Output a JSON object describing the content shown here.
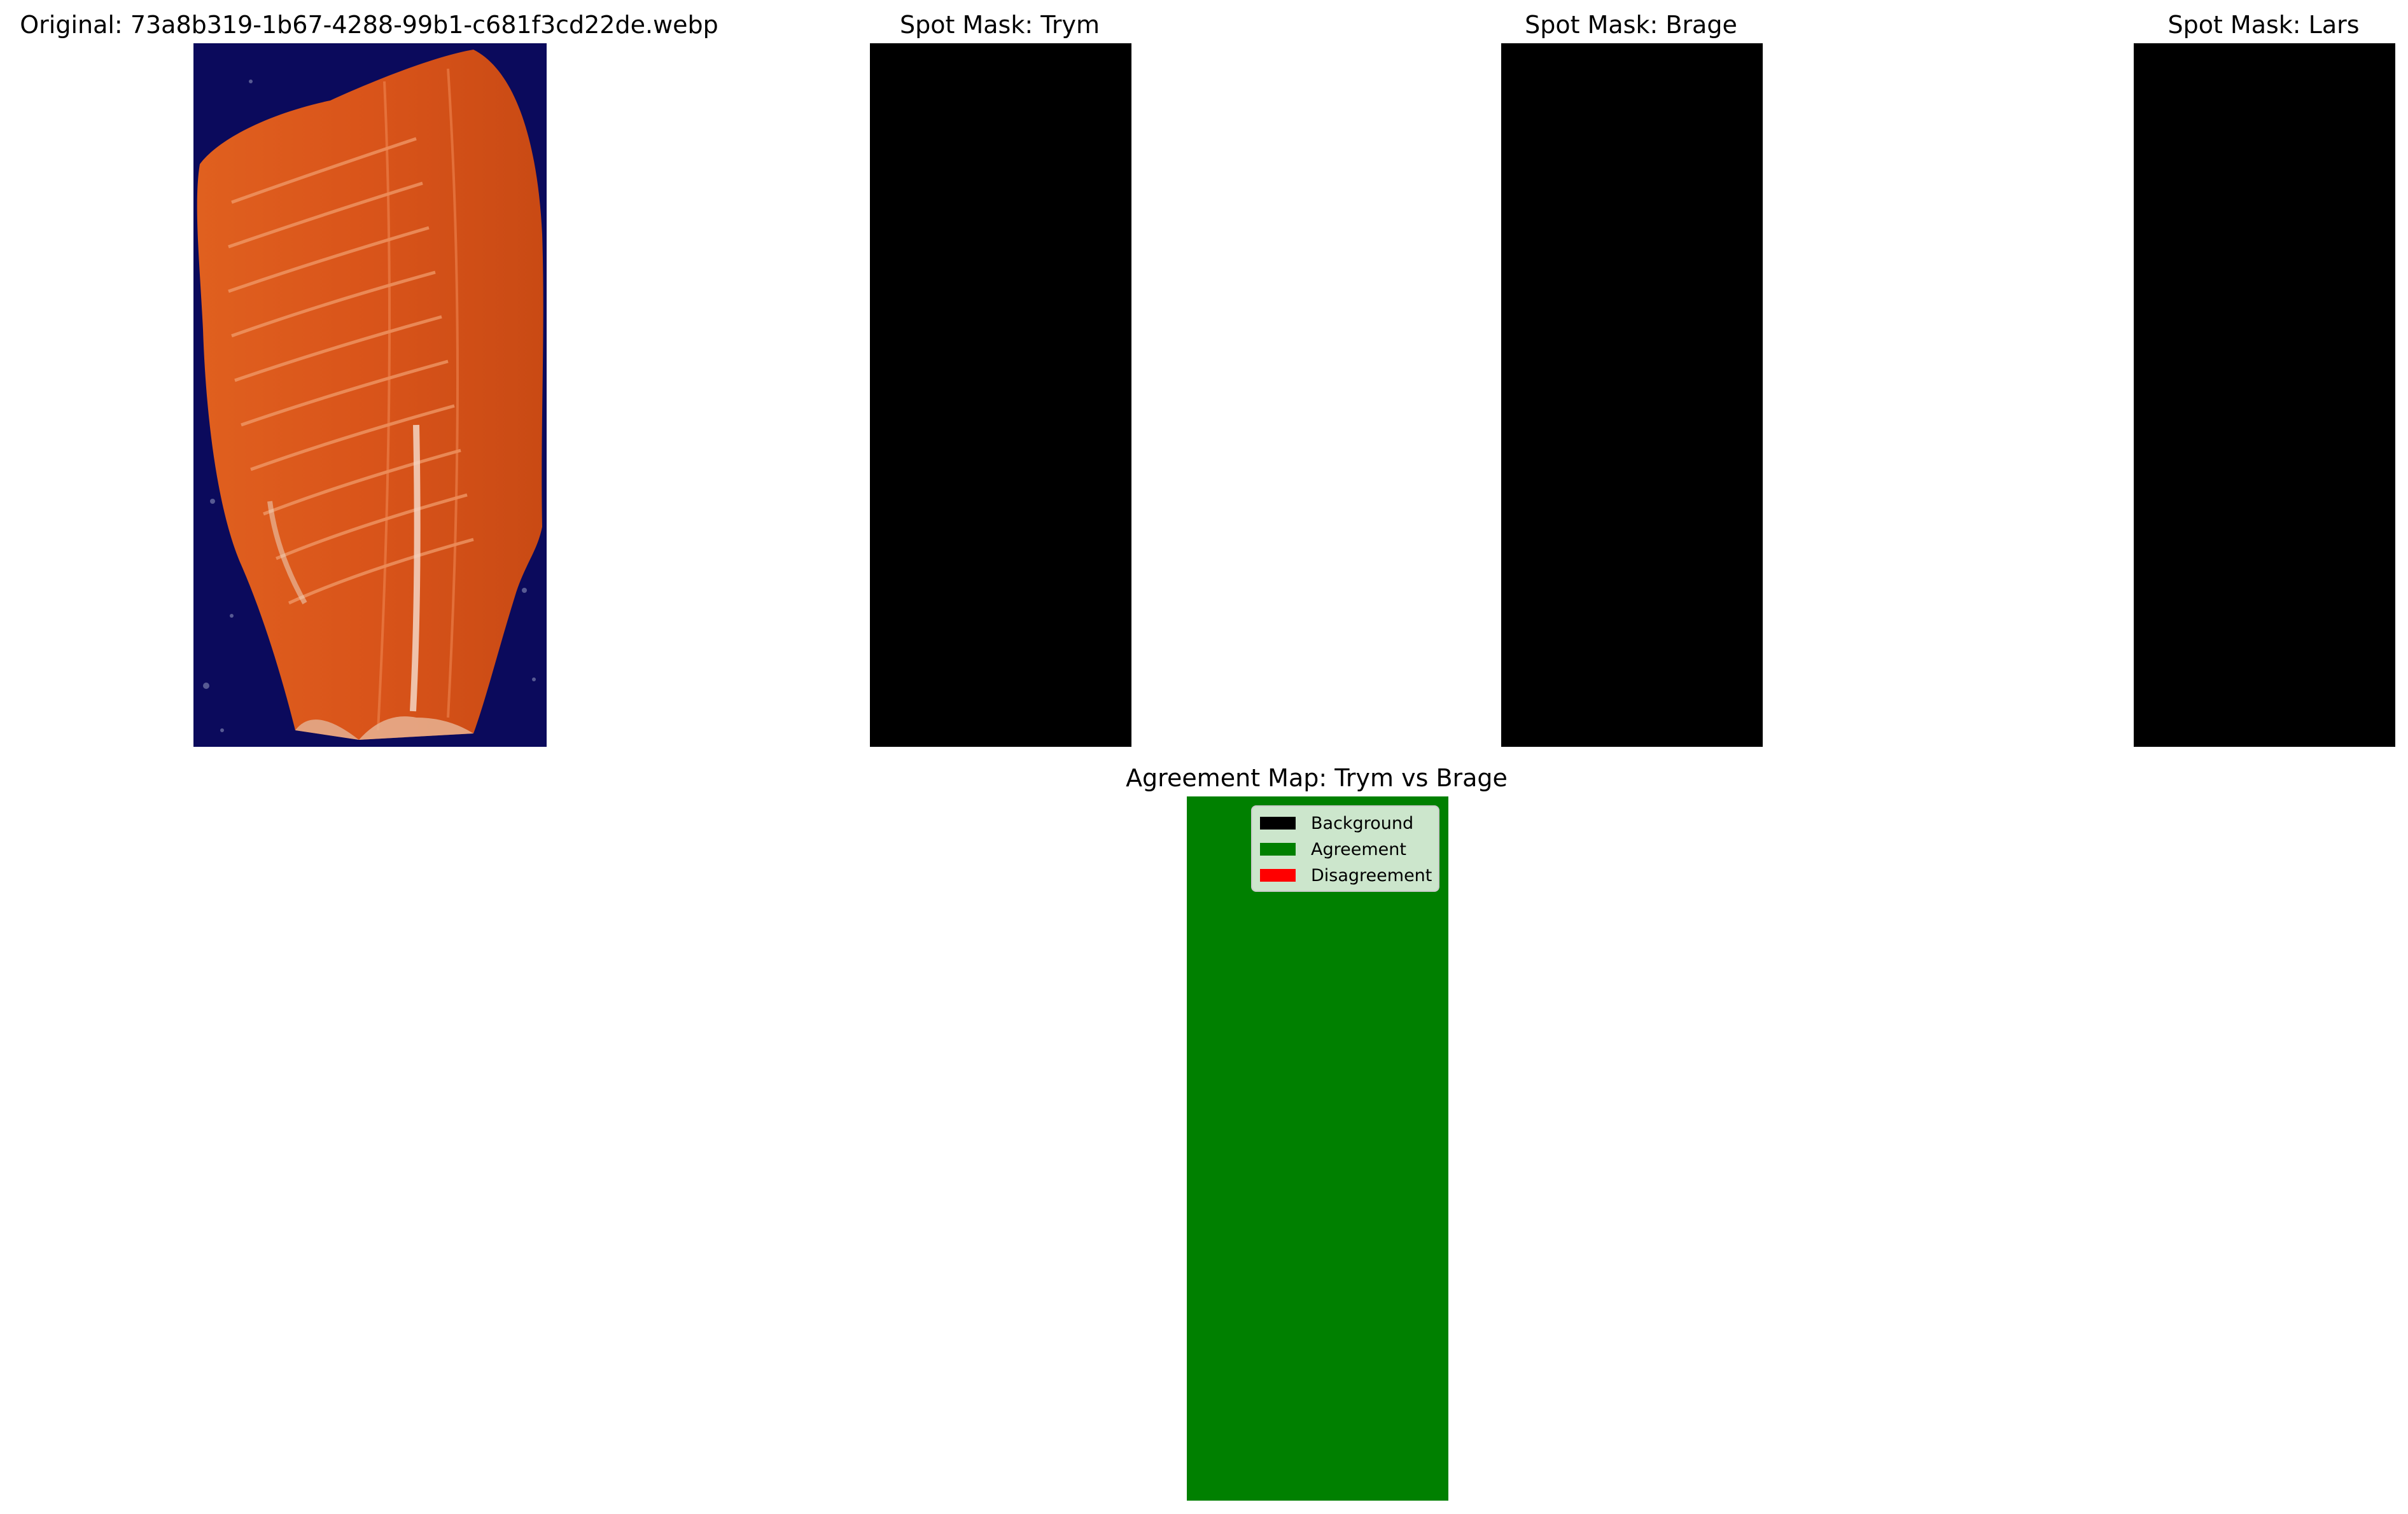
{
  "panels": {
    "original": {
      "title": "Original: 73a8b319-1b67-4288-99b1-c681f3cd22de.webp",
      "background_color": "#0b0a5c",
      "fillet_color": "#d9541a"
    },
    "mask_trym": {
      "title": "Spot Mask: Trym",
      "fill_color": "#000000"
    },
    "mask_brage": {
      "title": "Spot Mask: Brage",
      "fill_color": "#000000"
    },
    "mask_lars": {
      "title": "Spot Mask: Lars",
      "fill_color": "#000000"
    },
    "agreement": {
      "title": "Agreement Map: Trym vs Brage",
      "fill_color": "#008000",
      "legend": [
        {
          "label": "Background",
          "color": "#000000"
        },
        {
          "label": "Agreement",
          "color": "#008000"
        },
        {
          "label": "Disagreement",
          "color": "#ff0000"
        }
      ]
    }
  }
}
